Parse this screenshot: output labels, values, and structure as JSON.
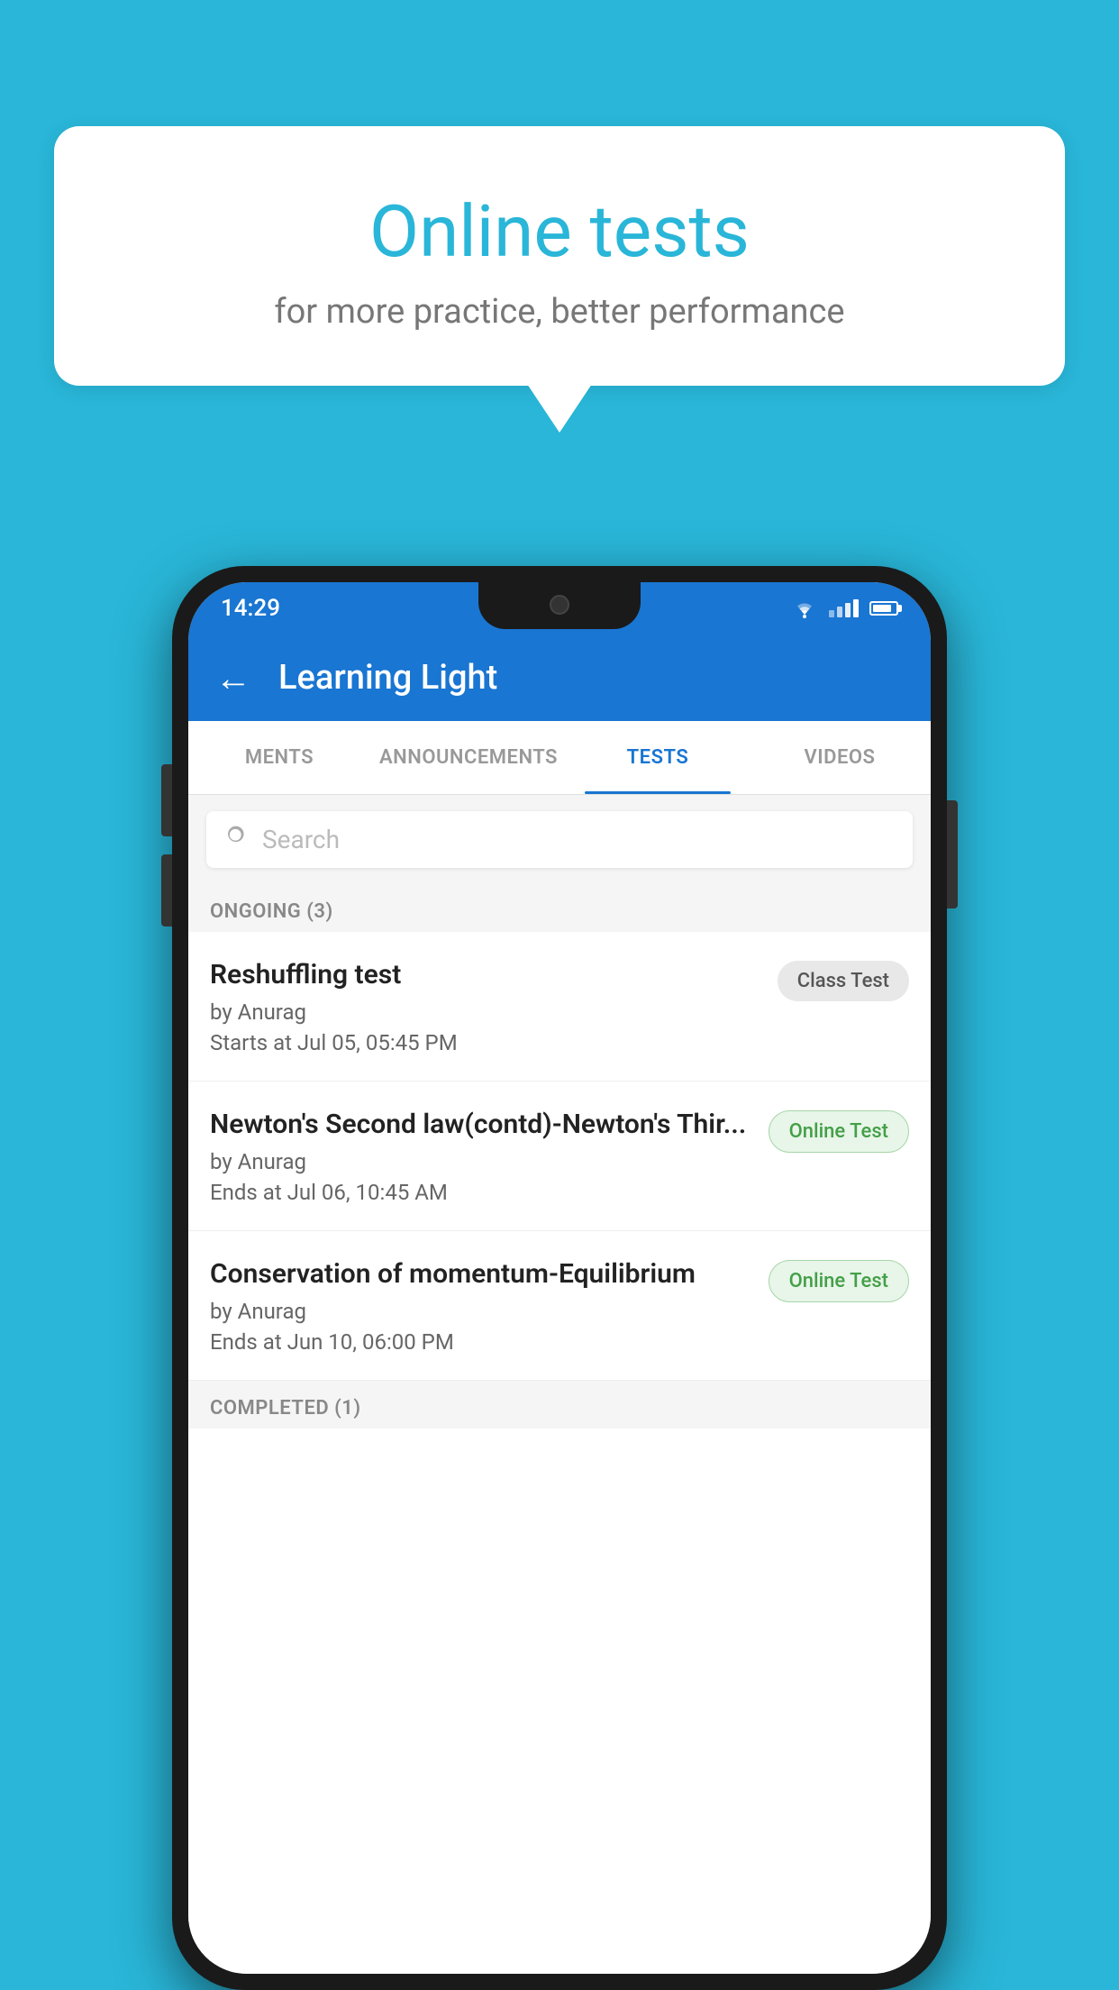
{
  "background_color": "#29b6d8",
  "speech_bubble": {
    "title": "Online tests",
    "subtitle": "for more practice, better performance"
  },
  "phone": {
    "status_bar": {
      "time": "14:29"
    },
    "app_header": {
      "title": "Learning Light",
      "back_label": "←"
    },
    "tabs": [
      {
        "label": "MENTS",
        "active": false
      },
      {
        "label": "ANNOUNCEMENTS",
        "active": false
      },
      {
        "label": "TESTS",
        "active": true
      },
      {
        "label": "VIDEOS",
        "active": false
      }
    ],
    "search": {
      "placeholder": "Search"
    },
    "ongoing_section": {
      "label": "ONGOING (3)",
      "tests": [
        {
          "name": "Reshuffling test",
          "author": "by Anurag",
          "date": "Starts at  Jul 05, 05:45 PM",
          "badge": "Class Test",
          "badge_type": "class"
        },
        {
          "name": "Newton's Second law(contd)-Newton's Thir...",
          "author": "by Anurag",
          "date": "Ends at  Jul 06, 10:45 AM",
          "badge": "Online Test",
          "badge_type": "online"
        },
        {
          "name": "Conservation of momentum-Equilibrium",
          "author": "by Anurag",
          "date": "Ends at  Jun 10, 06:00 PM",
          "badge": "Online Test",
          "badge_type": "online"
        }
      ]
    },
    "completed_section": {
      "label": "COMPLETED (1)"
    }
  }
}
